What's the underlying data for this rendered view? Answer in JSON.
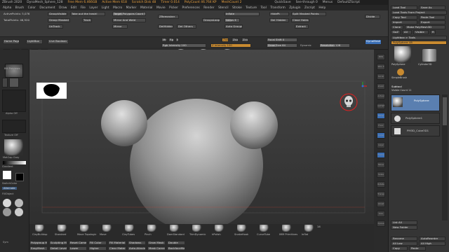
{
  "titlebar": {
    "app": "ZBrush 2020",
    "doc": "DynaMesh_Sphere_128",
    "free_mem": "Free Mem 6.466GB",
    "active_mem": "Active Mem 618",
    "scratch": "Scratch Disk 48",
    "timer": "Timer 0.014",
    "polycount": "PolyCount 46.764 KP",
    "meshcount": "MeshCount 2",
    "quicksave": "QuickSave",
    "seethrough": "See-through 0",
    "menus_label": "Menus",
    "script_label": "DefaultZScript"
  },
  "menu": [
    "Alpha",
    "Brush",
    "Color",
    "Document",
    "Draw",
    "Edit",
    "File",
    "Layer",
    "Light",
    "Macro",
    "Marker",
    "Material",
    "Movie",
    "Picker",
    "Preferences",
    "Render",
    "Stencil",
    "Stroke",
    "Texture",
    "Tool",
    "Transform",
    "Zplugin",
    "Zscript",
    "Help"
  ],
  "info": {
    "active_points": "ActivePoints: 5,076",
    "total_points": "TotalPoints: 46,920"
  },
  "top": {
    "group_visible": "GroupVisible",
    "take_out": "Take out the trash!",
    "group_masked": "Group Masked",
    "track": "Track",
    "untrack": "UnTrack",
    "target_poly": "Target Polygons Count 5",
    "mirror_weld": "Mirror And Weld",
    "mirror": "Mirror",
    "zremesher": "ZRemesher",
    "delhidden": "DelHidden",
    "delet": "DelLt",
    "del_others": "Del Others",
    "groups_loops": "GroupsLoops",
    "inflate": "Inflate",
    "loops": "Loops 4",
    "auto_groups": "Auto Groups",
    "hidept": "HidePt",
    "split_masked": "Split Masked Points",
    "del_hidden": "Del Hidden",
    "close_holes": "Close Holes",
    "extract": "Extract",
    "divide": "Divide"
  },
  "draw": {
    "mrgb": "Mrgb",
    "rgb": "Rgb",
    "m": "M",
    "zadd": "Zadd",
    "zsub": "Zsub",
    "zcut": "Zcut",
    "rgb_intensity": "Rgb Intensity 100",
    "z_intensity": "Z Intensity 100",
    "focal_shift": "Focal Shift 0",
    "draw_size": "Draw Size 64",
    "dynamic": "Dynamic",
    "resolution": "Resolution 128",
    "dynamesh": "DynaMesh",
    "insert_sphere": "Insert Sphere",
    "home": "Home Page",
    "lightbox": "LightBox",
    "live_boolean": "Live Boolean",
    "edit": "Edit",
    "draw_lbl": "Draw",
    "move": "Move",
    "scale": "Scale",
    "rotate": "Rotate"
  },
  "left": {
    "previews": "Bill Previews",
    "alpha_off": "Alpha Off",
    "texture_off": "Texture Off",
    "matcap": "MatCap Gray",
    "gradient": "Gradient",
    "switch_color": "SwitchColor",
    "alternate": "Alternate",
    "fillobject": "FillObject",
    "sym": "Sym"
  },
  "bottom_brushes": [
    "ClayBuildup",
    "Standard",
    "Move Topologic",
    "Move",
    "ClayTubes",
    "Pinch",
    "DamStandard",
    "TrimDynamic",
    "hPolish",
    "SnakeHook",
    "CurveTube",
    "IMM Primitives",
    "Inflat"
  ],
  "bottom_tools": [
    "Polygroup Mode",
    "Sculpting Mode",
    "Reset Camera",
    "Fill Color",
    "Fill Material",
    "Shadows",
    "Grow Mask",
    "Double",
    "EasyMesh",
    "Detail Level 5",
    "Lower",
    "Higher",
    "Clear Material",
    "Auto-Aliasing",
    "Mask Corners",
    "BackfaceMask"
  ],
  "bottom_count": "14",
  "rightstrip": [
    "BPR",
    "SPix 3",
    "Scroll",
    "Zoom",
    "Actual",
    "AAHalf",
    "Persp",
    "Floor",
    "Local",
    "Gxyz",
    "Frame",
    "Move",
    "Scale",
    "Rotate",
    "Transp",
    "Ghost",
    "Solo",
    "Xpose"
  ],
  "rightpanel": {
    "load_tool": "Load Tool",
    "save_as": "Save As",
    "load_tools_project": "Load Tools From Project",
    "copy_tool": "Copy Tool",
    "paste_tool": "Paste Tool",
    "import": "Import",
    "export": "Export",
    "clone": "Clone",
    "make_polymesh": "Make PolyMesh3D",
    "goz": "GoZ",
    "all": "All",
    "visible": "Visible",
    "r": "R",
    "lightbox_tools": "Lightbox > Tools",
    "polysphere": "PolySphere 48",
    "polysphere_thumb": "PolySphere",
    "cylinder": "Cylinder3D",
    "simple_brush": "SimpleBrush",
    "subtool": "Subtool",
    "visible_count": "Visible Count 11",
    "subtool1": "PolySphere",
    "subtool2": "PolySphere1",
    "pm3d": "PM3D_Cube3D1",
    "list_all": "List All",
    "new_folder": "New Folder",
    "rename": "Rename",
    "autoreorder": "AutoReorder",
    "all_low": "All Low",
    "all_high": "All High",
    "copy": "Copy",
    "paste": "Paste",
    "sym": "Sym"
  },
  "colors": {
    "accent": "#e8a040",
    "dynamesh": "#3b6fb5",
    "subtool_active": "#5a7fb0",
    "skull_ring": "#e22020"
  }
}
